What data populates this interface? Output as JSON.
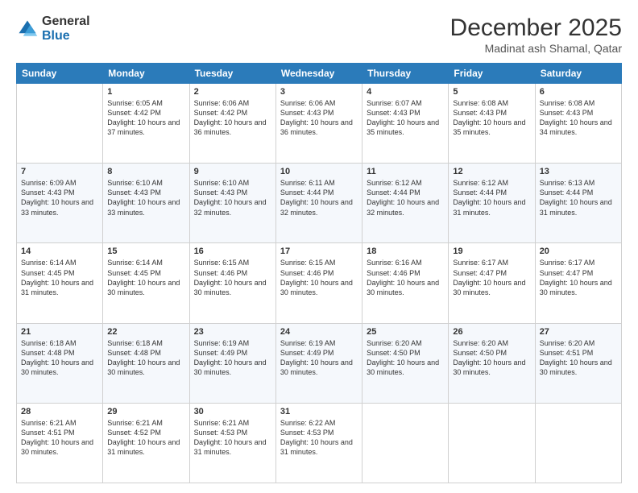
{
  "logo": {
    "line1": "General",
    "line2": "Blue"
  },
  "header": {
    "month_year": "December 2025",
    "location": "Madinat ash Shamal, Qatar"
  },
  "weekdays": [
    "Sunday",
    "Monday",
    "Tuesday",
    "Wednesday",
    "Thursday",
    "Friday",
    "Saturday"
  ],
  "weeks": [
    [
      {
        "day": "",
        "sunrise": "",
        "sunset": "",
        "daylight": ""
      },
      {
        "day": "1",
        "sunrise": "Sunrise: 6:05 AM",
        "sunset": "Sunset: 4:42 PM",
        "daylight": "Daylight: 10 hours and 37 minutes."
      },
      {
        "day": "2",
        "sunrise": "Sunrise: 6:06 AM",
        "sunset": "Sunset: 4:42 PM",
        "daylight": "Daylight: 10 hours and 36 minutes."
      },
      {
        "day": "3",
        "sunrise": "Sunrise: 6:06 AM",
        "sunset": "Sunset: 4:43 PM",
        "daylight": "Daylight: 10 hours and 36 minutes."
      },
      {
        "day": "4",
        "sunrise": "Sunrise: 6:07 AM",
        "sunset": "Sunset: 4:43 PM",
        "daylight": "Daylight: 10 hours and 35 minutes."
      },
      {
        "day": "5",
        "sunrise": "Sunrise: 6:08 AM",
        "sunset": "Sunset: 4:43 PM",
        "daylight": "Daylight: 10 hours and 35 minutes."
      },
      {
        "day": "6",
        "sunrise": "Sunrise: 6:08 AM",
        "sunset": "Sunset: 4:43 PM",
        "daylight": "Daylight: 10 hours and 34 minutes."
      }
    ],
    [
      {
        "day": "7",
        "sunrise": "Sunrise: 6:09 AM",
        "sunset": "Sunset: 4:43 PM",
        "daylight": "Daylight: 10 hours and 33 minutes."
      },
      {
        "day": "8",
        "sunrise": "Sunrise: 6:10 AM",
        "sunset": "Sunset: 4:43 PM",
        "daylight": "Daylight: 10 hours and 33 minutes."
      },
      {
        "day": "9",
        "sunrise": "Sunrise: 6:10 AM",
        "sunset": "Sunset: 4:43 PM",
        "daylight": "Daylight: 10 hours and 32 minutes."
      },
      {
        "day": "10",
        "sunrise": "Sunrise: 6:11 AM",
        "sunset": "Sunset: 4:44 PM",
        "daylight": "Daylight: 10 hours and 32 minutes."
      },
      {
        "day": "11",
        "sunrise": "Sunrise: 6:12 AM",
        "sunset": "Sunset: 4:44 PM",
        "daylight": "Daylight: 10 hours and 32 minutes."
      },
      {
        "day": "12",
        "sunrise": "Sunrise: 6:12 AM",
        "sunset": "Sunset: 4:44 PM",
        "daylight": "Daylight: 10 hours and 31 minutes."
      },
      {
        "day": "13",
        "sunrise": "Sunrise: 6:13 AM",
        "sunset": "Sunset: 4:44 PM",
        "daylight": "Daylight: 10 hours and 31 minutes."
      }
    ],
    [
      {
        "day": "14",
        "sunrise": "Sunrise: 6:14 AM",
        "sunset": "Sunset: 4:45 PM",
        "daylight": "Daylight: 10 hours and 31 minutes."
      },
      {
        "day": "15",
        "sunrise": "Sunrise: 6:14 AM",
        "sunset": "Sunset: 4:45 PM",
        "daylight": "Daylight: 10 hours and 30 minutes."
      },
      {
        "day": "16",
        "sunrise": "Sunrise: 6:15 AM",
        "sunset": "Sunset: 4:46 PM",
        "daylight": "Daylight: 10 hours and 30 minutes."
      },
      {
        "day": "17",
        "sunrise": "Sunrise: 6:15 AM",
        "sunset": "Sunset: 4:46 PM",
        "daylight": "Daylight: 10 hours and 30 minutes."
      },
      {
        "day": "18",
        "sunrise": "Sunrise: 6:16 AM",
        "sunset": "Sunset: 4:46 PM",
        "daylight": "Daylight: 10 hours and 30 minutes."
      },
      {
        "day": "19",
        "sunrise": "Sunrise: 6:17 AM",
        "sunset": "Sunset: 4:47 PM",
        "daylight": "Daylight: 10 hours and 30 minutes."
      },
      {
        "day": "20",
        "sunrise": "Sunrise: 6:17 AM",
        "sunset": "Sunset: 4:47 PM",
        "daylight": "Daylight: 10 hours and 30 minutes."
      }
    ],
    [
      {
        "day": "21",
        "sunrise": "Sunrise: 6:18 AM",
        "sunset": "Sunset: 4:48 PM",
        "daylight": "Daylight: 10 hours and 30 minutes."
      },
      {
        "day": "22",
        "sunrise": "Sunrise: 6:18 AM",
        "sunset": "Sunset: 4:48 PM",
        "daylight": "Daylight: 10 hours and 30 minutes."
      },
      {
        "day": "23",
        "sunrise": "Sunrise: 6:19 AM",
        "sunset": "Sunset: 4:49 PM",
        "daylight": "Daylight: 10 hours and 30 minutes."
      },
      {
        "day": "24",
        "sunrise": "Sunrise: 6:19 AM",
        "sunset": "Sunset: 4:49 PM",
        "daylight": "Daylight: 10 hours and 30 minutes."
      },
      {
        "day": "25",
        "sunrise": "Sunrise: 6:20 AM",
        "sunset": "Sunset: 4:50 PM",
        "daylight": "Daylight: 10 hours and 30 minutes."
      },
      {
        "day": "26",
        "sunrise": "Sunrise: 6:20 AM",
        "sunset": "Sunset: 4:50 PM",
        "daylight": "Daylight: 10 hours and 30 minutes."
      },
      {
        "day": "27",
        "sunrise": "Sunrise: 6:20 AM",
        "sunset": "Sunset: 4:51 PM",
        "daylight": "Daylight: 10 hours and 30 minutes."
      }
    ],
    [
      {
        "day": "28",
        "sunrise": "Sunrise: 6:21 AM",
        "sunset": "Sunset: 4:51 PM",
        "daylight": "Daylight: 10 hours and 30 minutes."
      },
      {
        "day": "29",
        "sunrise": "Sunrise: 6:21 AM",
        "sunset": "Sunset: 4:52 PM",
        "daylight": "Daylight: 10 hours and 31 minutes."
      },
      {
        "day": "30",
        "sunrise": "Sunrise: 6:21 AM",
        "sunset": "Sunset: 4:53 PM",
        "daylight": "Daylight: 10 hours and 31 minutes."
      },
      {
        "day": "31",
        "sunrise": "Sunrise: 6:22 AM",
        "sunset": "Sunset: 4:53 PM",
        "daylight": "Daylight: 10 hours and 31 minutes."
      },
      {
        "day": "",
        "sunrise": "",
        "sunset": "",
        "daylight": ""
      },
      {
        "day": "",
        "sunrise": "",
        "sunset": "",
        "daylight": ""
      },
      {
        "day": "",
        "sunrise": "",
        "sunset": "",
        "daylight": ""
      }
    ]
  ]
}
